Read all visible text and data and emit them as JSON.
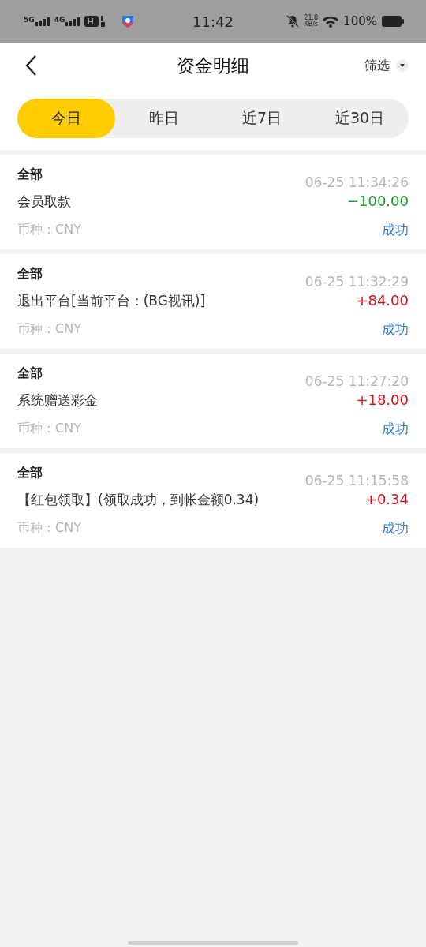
{
  "status_bar": {
    "network_1": "5G",
    "network_2": "4G",
    "time": "11:42",
    "speed_value": "21.8",
    "speed_unit": "KB/s",
    "battery": "100%"
  },
  "header": {
    "title": "资金明细",
    "filter": "筛选"
  },
  "tabs": [
    {
      "label": "今日",
      "selected": true
    },
    {
      "label": "昨日",
      "selected": false
    },
    {
      "label": "近7日",
      "selected": false
    },
    {
      "label": "近30日",
      "selected": false
    }
  ],
  "records": [
    {
      "category": "全部",
      "time": "06-25 11:34:26",
      "description": "会员取款",
      "amount": "−100.00",
      "kind": "debit",
      "currency": "币种：CNY",
      "status": "成功"
    },
    {
      "category": "全部",
      "time": "06-25 11:32:29",
      "description": "退出平台[当前平台：(BG视讯)]",
      "amount": "+84.00",
      "kind": "credit",
      "currency": "币种：CNY",
      "status": "成功"
    },
    {
      "category": "全部",
      "time": "06-25 11:27:20",
      "description": "系统赠送彩金",
      "amount": "+18.00",
      "kind": "credit",
      "currency": "币种：CNY",
      "status": "成功"
    },
    {
      "category": "全部",
      "time": "06-25 11:15:58",
      "description": "【红包领取】(领取成功，到帐金额0.34)",
      "amount": "+0.34",
      "kind": "credit",
      "currency": "币种：CNY",
      "status": "成功"
    }
  ]
}
